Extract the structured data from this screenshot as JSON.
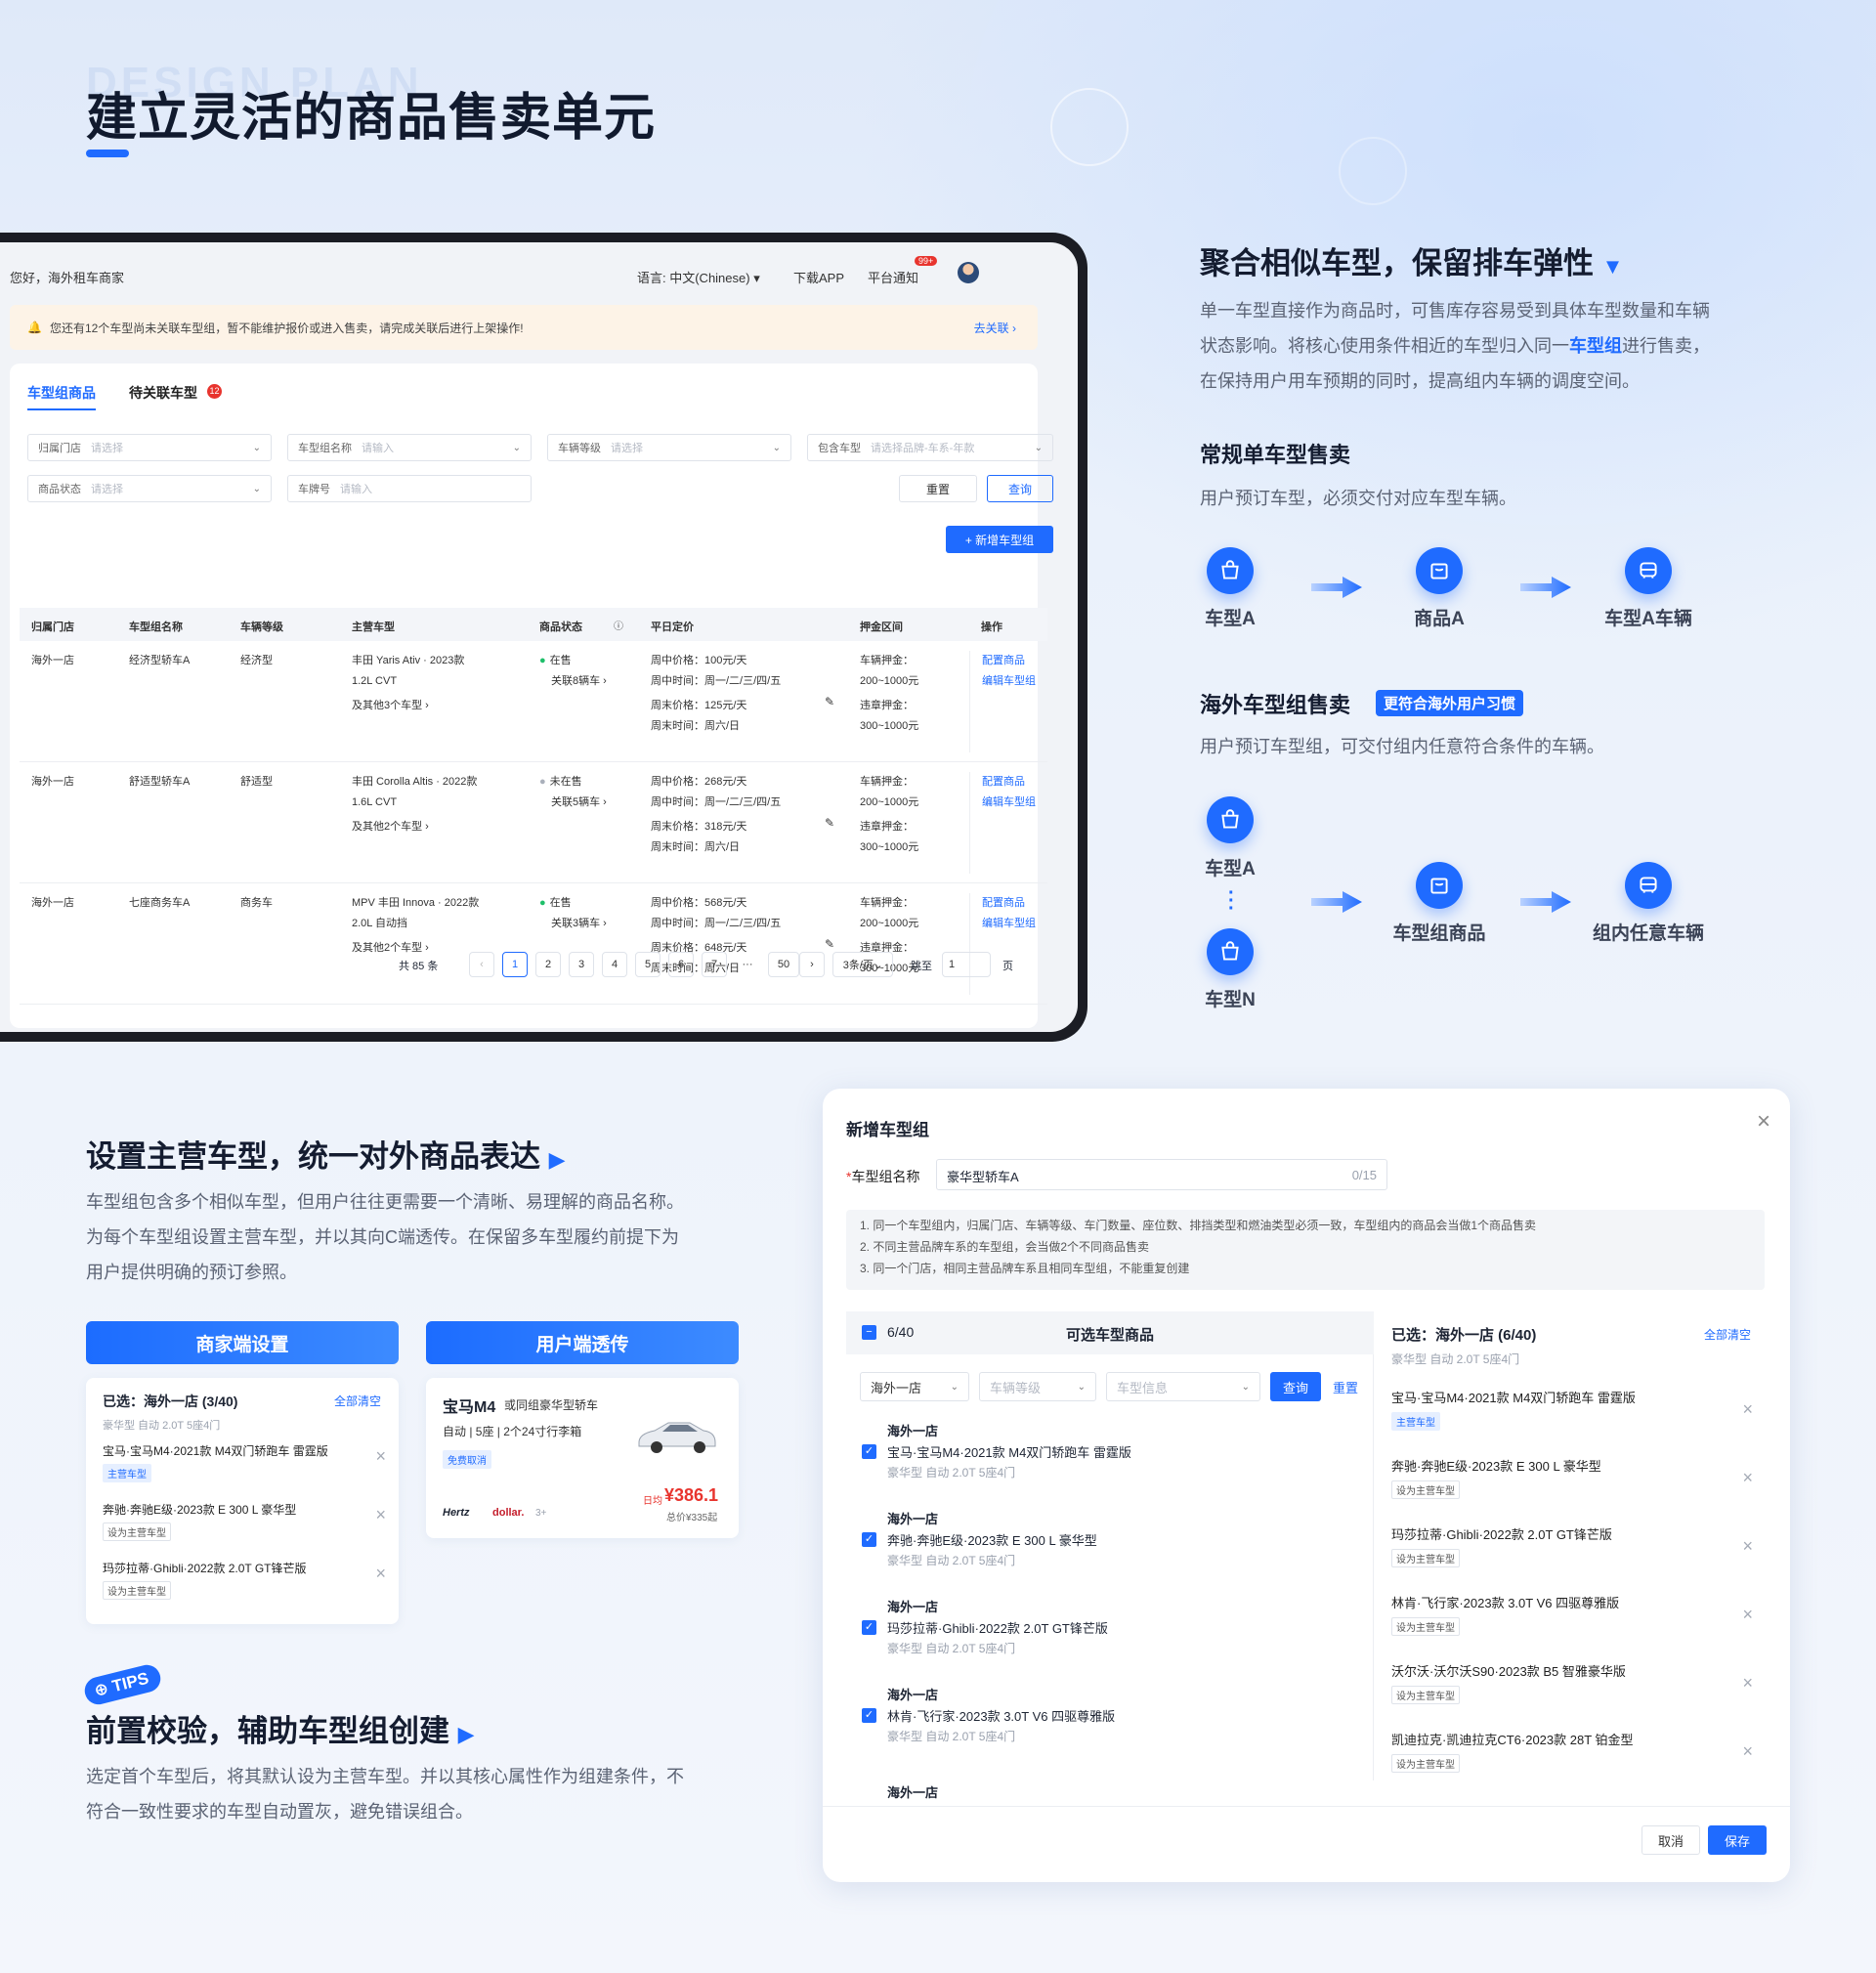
{
  "header": {
    "ghost": "DESIGN PLAN",
    "title": "建立灵活的商品售卖单元"
  },
  "screen": {
    "greeting": "您好，海外租车商家",
    "language": "语言: 中文(Chinese)",
    "download": "下载APP",
    "notice": "平台通知",
    "notice_badge": "99+",
    "warning": "您还有12个车型尚未关联车型组，暂不能维护报价或进入售卖，请完成关联后进行上架操作!",
    "warning_link": "去关联",
    "tabs": [
      {
        "label": "车型组商品"
      },
      {
        "label": "待关联车型",
        "badge": "12"
      }
    ],
    "filters": [
      {
        "label": "归属门店",
        "placeholder": "请选择"
      },
      {
        "label": "车型组名称",
        "placeholder": "请输入"
      },
      {
        "label": "车辆等级",
        "placeholder": "请选择"
      },
      {
        "label": "包含车型",
        "placeholder": "请选择品牌-车系-年款"
      },
      {
        "label": "商品状态",
        "placeholder": "请选择"
      },
      {
        "label": "车牌号",
        "placeholder": "请输入"
      }
    ],
    "reset": "重置",
    "query": "查询",
    "add": "+ 新增车型组",
    "columns": [
      "归属门店",
      "车型组名称",
      "车辆等级",
      "主营车型",
      "商品状态",
      "平日定价",
      "押金区间",
      "操作"
    ],
    "rows": [
      {
        "store": "海外一店",
        "group": "经济型轿车A",
        "level": "经济型",
        "model1": "丰田 Yaris Ativ · 2023款",
        "model2": "1.2L CVT",
        "others": "及其他3个车型 ›",
        "status": "在售",
        "linked": "关联8辆车 ›",
        "p1": "周中价格：100元/天",
        "p2": "周中时间：周一/二/三/四/五",
        "p3": "周末价格：125元/天",
        "p4": "周末时间：周六/日",
        "d1": "车辆押金：",
        "d2": "200~1000元",
        "d3": "违章押金：",
        "d4": "300~1000元",
        "a1": "配置商品",
        "a2": "编辑车型组"
      },
      {
        "store": "海外一店",
        "group": "舒适型轿车A",
        "level": "舒适型",
        "model1": "丰田 Corolla Altis · 2022款",
        "model2": "1.6L CVT",
        "others": "及其他2个车型 ›",
        "status": "未在售",
        "linked": "关联5辆车 ›",
        "p1": "周中价格：268元/天",
        "p2": "周中时间：周一/二/三/四/五",
        "p3": "周末价格：318元/天",
        "p4": "周末时间：周六/日",
        "d1": "车辆押金：",
        "d2": "200~1000元",
        "d3": "违章押金：",
        "d4": "300~1000元",
        "a1": "配置商品",
        "a2": "编辑车型组"
      },
      {
        "store": "海外一店",
        "group": "七座商务车A",
        "level": "商务车",
        "model1": "MPV 丰田 Innova · 2022款",
        "model2": "2.0L 自动挡",
        "others": "及其他2个车型 ›",
        "status": "在售",
        "linked": "关联3辆车 ›",
        "p1": "周中价格：568元/天",
        "p2": "周中时间：周一/二/三/四/五",
        "p3": "周末价格：648元/天",
        "p4": "周末时间：周六/日",
        "d1": "车辆押金：",
        "d2": "200~1000元",
        "d3": "违章押金：",
        "d4": "300~1000元",
        "a1": "配置商品",
        "a2": "编辑车型组"
      }
    ],
    "pagination": {
      "total": "共 85 条",
      "pages": [
        "1",
        "2",
        "3",
        "4",
        "5",
        "6",
        "7",
        "···",
        "50"
      ],
      "page_size": "3条/页",
      "jump": "跳至",
      "jump_value": "1",
      "page_unit": "页"
    }
  },
  "sec1": {
    "title": "聚合相似车型，保留排车弹性",
    "p_a": "单一车型直接作为商品时，可售库存容易受到具体车型数量和车辆",
    "p_b": "状态影响。将核心使用条件相近的车型归入同一",
    "p_hl": "车型组",
    "p_c": "进行售卖，",
    "p_d": "在保持用户用车预期的同时，提高组内车辆的调度空间。",
    "h_single": "常规单车型售卖",
    "p_single": "用户预订车型，必须交付对应车型车辆。",
    "flow1": [
      "车型A",
      "商品A",
      "车型A车辆"
    ],
    "h_group": "海外车型组售卖",
    "badge": "更符合海外用户习惯",
    "p_group": "用户预订车型组，可交付组内任意符合条件的车辆。",
    "flow2": [
      "车型A",
      "车型N",
      "车型组商品",
      "组内任意车辆"
    ]
  },
  "sec2": {
    "title": "设置主营车型，统一对外商品表达",
    "p1": "车型组包含多个相似车型，但用户往往更需要一个清晰、易理解的商品名称。",
    "p2": "为每个车型组设置主营车型，并以其向C端透传。在保留多车型履约前提下为",
    "p3": "用户提供明确的预订参照。",
    "btn_merchant": "商家端设置",
    "btn_user": "用户端透传",
    "merchant": {
      "selected": "已选：海外一店 (3/40)",
      "clear": "全部清空",
      "meta": "豪华型  自动  2.0T  5座4门",
      "items": [
        {
          "name": "宝马·宝马M4·2021款 M4双门轿跑车 雷霆版",
          "tag": "主营车型"
        },
        {
          "name": "奔驰·奔驰E级·2023款 E 300 L 豪华型",
          "tag": "设为主营车型"
        },
        {
          "name": "玛莎拉蒂·Ghibli·2022款 2.0T GT锋芒版",
          "tag": "设为主营车型"
        }
      ]
    },
    "user": {
      "name": "宝马M4",
      "sub": "或同组豪华型轿车",
      "spec": "自动 | 5座 | 2个24寸行李箱",
      "cancel": "免费取消",
      "brand1": "Hertz",
      "brand2": "dollar.",
      "more": "3+",
      "unit": "日均",
      "price": "¥386.1",
      "total": "总价¥335起"
    }
  },
  "sec3": {
    "tips": "TIPS",
    "title": "前置校验，辅助车型组创建",
    "p1": "选定首个车型后，将其默认设为主营车型。并以其核心属性作为组建条件，不",
    "p2": "符合一致性要求的车型自动置灰，避免错误组合。"
  },
  "modal": {
    "title": "新增车型组",
    "name_label": "车型组名称",
    "name_value": "豪华型轿车A",
    "counter": "0/15",
    "notes": [
      "1. 同一个车型组内，归属门店、车辆等级、车门数量、座位数、排挡类型和燃油类型必须一致，车型组内的商品会当做1个商品售卖",
      "2. 不同主营品牌车系的车型组，会当做2个不同商品售卖",
      "3. 同一个门店，相同主营品牌车系且相同车型组，不能重复创建"
    ],
    "left": {
      "count": "6/40",
      "title": "可选车型商品",
      "f1": "海外一店",
      "f2": "车辆等级",
      "f3": "车型信息",
      "query": "查询",
      "reset": "重置",
      "items": [
        {
          "store": "海外一店",
          "name": "宝马·宝马M4·2021款 M4双门轿跑车 雷霆版",
          "meta": "豪华型  自动  2.0T  5座4门"
        },
        {
          "store": "海外一店",
          "name": "奔驰·奔驰E级·2023款 E 300 L 豪华型",
          "meta": "豪华型  自动  2.0T  5座4门"
        },
        {
          "store": "海外一店",
          "name": "玛莎拉蒂·Ghibli·2022款 2.0T GT锋芒版",
          "meta": "豪华型  自动  2.0T  5座4门"
        },
        {
          "store": "海外一店",
          "name": "林肯·飞行家·2023款 3.0T V6 四驱尊雅版",
          "meta": "豪华型  自动  2.0T  5座4门"
        }
      ],
      "last_store": "海外一店"
    },
    "right": {
      "selected": "已选：海外一店 (6/40)",
      "clear": "全部清空",
      "meta": "豪华型  自动  2.0T  5座4门",
      "items": [
        {
          "name": "宝马·宝马M4·2021款 M4双门轿跑车 雷霆版",
          "tag": "主营车型"
        },
        {
          "name": "奔驰·奔驰E级·2023款 E 300 L 豪华型",
          "tag": "设为主营车型"
        },
        {
          "name": "玛莎拉蒂·Ghibli·2022款 2.0T GT锋芒版",
          "tag": "设为主营车型"
        },
        {
          "name": "林肯·飞行家·2023款 3.0T V6 四驱尊雅版",
          "tag": "设为主营车型"
        },
        {
          "name": "沃尔沃·沃尔沃S90·2023款 B5 智雅豪华版",
          "tag": "设为主营车型"
        },
        {
          "name": "凯迪拉克·凯迪拉克CT6·2023款 28T 铂金型",
          "tag": "设为主营车型"
        }
      ]
    },
    "cancel": "取消",
    "save": "保存"
  },
  "colors": {
    "accent": "#1f6bff",
    "title": "#111a2e",
    "text": "#5b6374"
  }
}
